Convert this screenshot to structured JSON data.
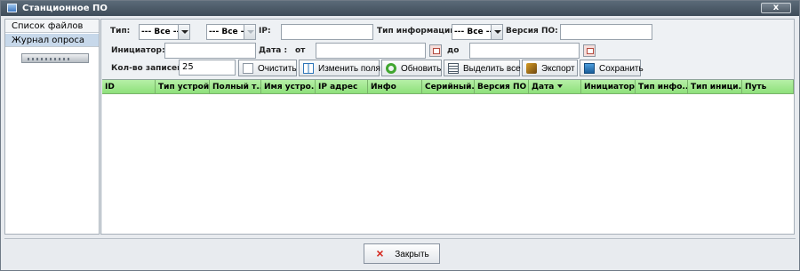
{
  "window": {
    "title": "Станционное ПО",
    "close_label": "x"
  },
  "sidebar": {
    "items": [
      {
        "label": "Список файлов ПО",
        "selected": false
      },
      {
        "label": "Журнал опроса",
        "selected": true
      }
    ]
  },
  "filters": {
    "type_label": "Тип:",
    "type_value": "--- Все ---",
    "type_second_value": "--- Все ---",
    "ip_label": "IP:",
    "ip_value": "",
    "info_type_label": "Тип информации:",
    "info_type_value": "--- Все ---",
    "version_label": "Версия ПО:",
    "version_value": "",
    "initiator_label": "Инициатор:",
    "initiator_value": "",
    "date_label": "Дата :",
    "from_label": "от",
    "from_value": "",
    "to_label": "до",
    "to_value": "",
    "records_label": "Кол-во записей:",
    "records_value": "25"
  },
  "toolbar": {
    "clear": "Очистить",
    "change_fields": "Изменить поля",
    "refresh": "Обновить",
    "select_all": "Выделить все",
    "export": "Экспорт",
    "save": "Сохранить"
  },
  "table": {
    "columns": [
      "ID",
      "Тип устрой...",
      "Полный т...",
      "Имя устро...",
      "IP адрес",
      "Инфо",
      "Серийный...",
      "Версия ПО",
      "Дата",
      "Инициатор",
      "Тип инфо...",
      "Тип иници...",
      "Путь"
    ],
    "sorted_column": "Дата",
    "rows": []
  },
  "footer": {
    "close_label": "Закрыть"
  },
  "colors": {
    "header_green": "#99e783",
    "selected_tab": "#c7d8ea",
    "title_bar": "#485665"
  }
}
